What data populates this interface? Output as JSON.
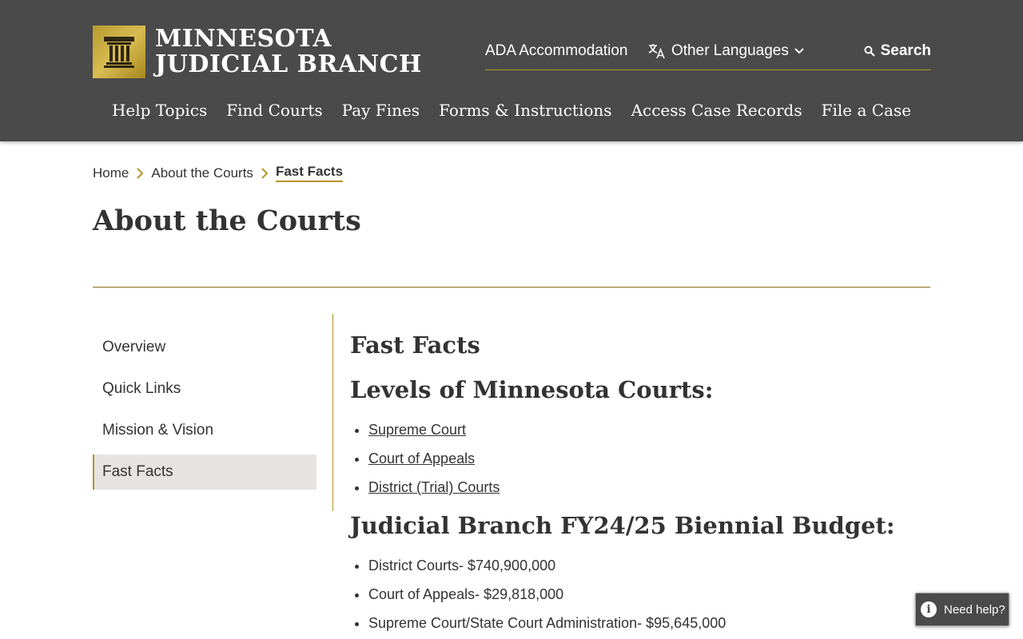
{
  "header": {
    "logo_line1": "MINNESOTA",
    "logo_line2": "JUDICIAL BRANCH",
    "utility": {
      "ada": "ADA Accommodation",
      "languages": "Other Languages",
      "search": "Search"
    },
    "nav": [
      "Help Topics",
      "Find Courts",
      "Pay Fines",
      "Forms & Instructions",
      "Access Case Records",
      "File a Case"
    ]
  },
  "breadcrumb": {
    "items": [
      "Home",
      "About the Courts"
    ],
    "current": "Fast Facts"
  },
  "page_title": "About the Courts",
  "side_nav": {
    "items": [
      "Overview",
      "Quick Links",
      "Mission & Vision",
      "Fast Facts"
    ],
    "active": "Fast Facts"
  },
  "content": {
    "heading": "Fast Facts",
    "levels_heading": "Levels of Minnesota Courts:",
    "levels": [
      "Supreme Court",
      "Court of Appeals",
      "District (Trial) Courts"
    ],
    "budget_heading": "Judicial Branch FY24/25 Biennial Budget:",
    "budget": [
      "District Courts- $740,900,000",
      "Court of Appeals- $29,818,000",
      "Supreme Court/State Court Administration- $95,645,000"
    ]
  },
  "help_button": "Need help?",
  "colors": {
    "header_bg": "#4a4a4a",
    "accent_gold": "#b8922b",
    "text": "#333333"
  }
}
